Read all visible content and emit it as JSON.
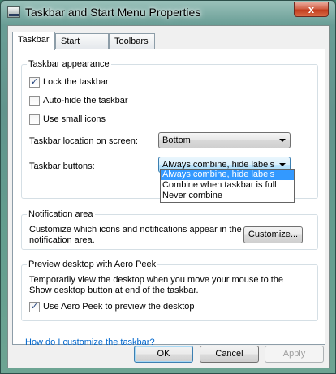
{
  "window": {
    "title": "Taskbar and Start Menu Properties",
    "close_label": "x"
  },
  "tabs": [
    {
      "label": "Taskbar",
      "active": true
    },
    {
      "label": "Start Menu",
      "active": false
    },
    {
      "label": "Toolbars",
      "active": false
    }
  ],
  "appearance": {
    "title": "Taskbar appearance",
    "lock_label": "Lock the taskbar",
    "lock_checked": true,
    "autohide_label": "Auto-hide the taskbar",
    "autohide_checked": false,
    "small_icons_label": "Use small icons",
    "small_icons_checked": false,
    "location_label": "Taskbar location on screen:",
    "location_value": "Bottom",
    "buttons_label": "Taskbar buttons:",
    "buttons_value": "Always combine, hide labels",
    "buttons_options": [
      "Always combine, hide labels",
      "Combine when taskbar is full",
      "Never combine"
    ]
  },
  "notification": {
    "title": "Notification area",
    "text_line1": "Customize which icons and notifications appear in the",
    "text_line2": "notification area.",
    "customize_label": "Customize..."
  },
  "aero_peek": {
    "title": "Preview desktop with Aero Peek",
    "text_line1": "Temporarily view the desktop when you move your mouse to the",
    "text_line2": "Show desktop button at end of the taskbar.",
    "checkbox_label": "Use Aero Peek to preview the desktop",
    "checkbox_checked": true
  },
  "help_link": "How do I customize the taskbar?",
  "buttons": {
    "ok": "OK",
    "cancel": "Cancel",
    "apply": "Apply"
  }
}
